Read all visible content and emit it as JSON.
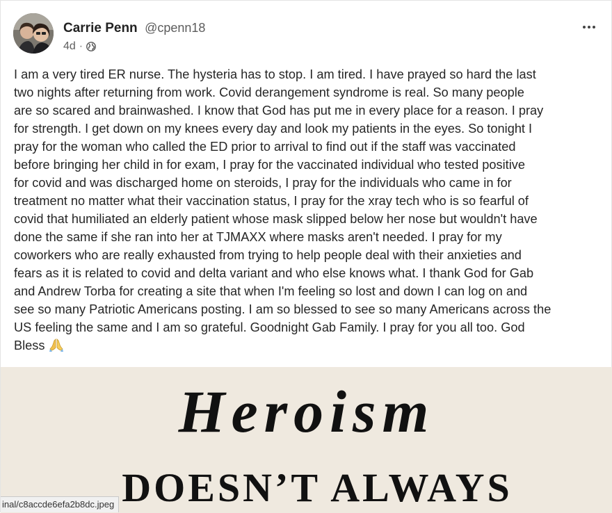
{
  "post": {
    "author": {
      "display_name": "Carrie Penn",
      "handle": "@cpenn18"
    },
    "timestamp": "4d",
    "separator": "·",
    "visibility_icon": "globe-icon",
    "more_icon": "more-options-icon",
    "text_lines": [
      "I am a very tired ER nurse. The hysteria has to stop. I am tired. I have prayed so hard the last",
      "two nights after returning from work. Covid derangement syndrome is real. So many people",
      "are so scared and brainwashed. I know that God has put me in every place for a reason. I pray",
      "for strength. I get down on my knees every day and look my patients in the eyes. So tonight I",
      "pray for the woman who called the ED prior to arrival to find out if the staff was vaccinated",
      "before bringing her child in for exam, I pray for the vaccinated individual who tested positive",
      "for covid and was discharged home on steroids, I pray for the individuals who came in for",
      "treatment no matter what their vaccination status, I pray for the xray tech who is so fearful of",
      "covid that humiliated an elderly patient whose mask slipped below her nose but wouldn't have",
      "done the same if she ran into her at TJMAXX where masks aren't needed. I pray for my",
      "coworkers who are really exhausted from trying to help people deal with their anxieties and",
      "fears as it is related to covid and delta variant and who else knows what. I thank God for Gab",
      "and Andrew Torba for creating a site that when I'm feeling so lost and down I can log on and",
      "see so many Patriotic Americans posting. I am so blessed to see so many Americans across the",
      "US feeling the same and I am so grateful. Goodnight Gab Family. I pray for you all too. God",
      "Bless"
    ],
    "emoji": "praying-hands-icon",
    "media": {
      "title": "Heroism",
      "subtitle": "DOESN’T ALWAYS"
    }
  },
  "status_bar": {
    "url": "inal/c8accde6efa2b8dc.jpeg"
  }
}
